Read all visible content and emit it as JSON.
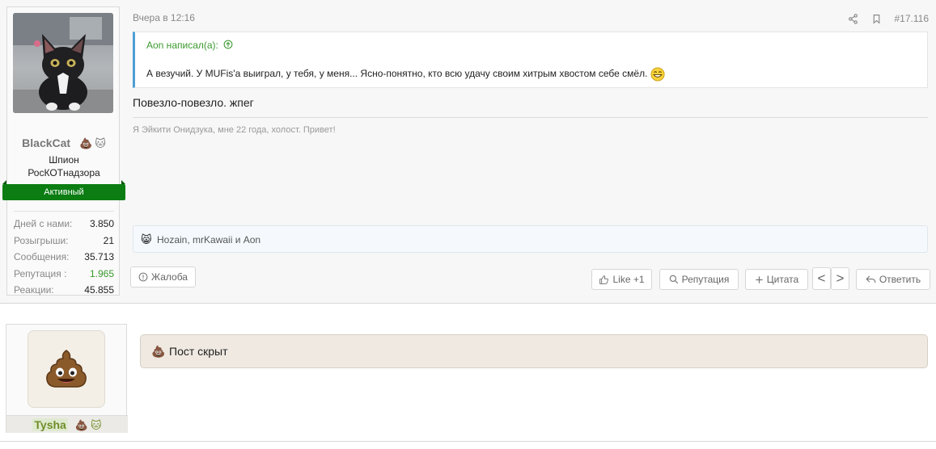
{
  "post1": {
    "user": {
      "name": "BlackCat",
      "badges": [
        "💩",
        "🐱"
      ],
      "title_line1": "Шпион",
      "title_line2": "РосКОТнадзора",
      "banner": "Активный",
      "stats": [
        {
          "label": "Дней с нами:",
          "value": "3.850"
        },
        {
          "label": "Розыгрыши:",
          "value": "21"
        },
        {
          "label": "Сообщения:",
          "value": "35.713"
        },
        {
          "label": "Репутация :",
          "value": "1.965"
        },
        {
          "label": "Реакции:",
          "value": "45.855"
        }
      ]
    },
    "date": "Вчера в 12:16",
    "post_number": "#17.116",
    "quote": {
      "author": "Aon написал(а):",
      "text": "А везучий. У MUFis'а выиграл, у тебя, у меня... Ясно-понятно, кто всю удачу своим хитрым хвостом себе смёл."
    },
    "text": "Повезло-повезло. жпег",
    "signature": "Я Эйкити Онидзука, мне 22 года, холост. Привет!",
    "reactions": {
      "emoji": "😸",
      "names": "Hozain, mrKawaii и Aon"
    },
    "actions": {
      "report": "Жалоба",
      "like": "Like +1",
      "reputation": "Репутация",
      "quote": "Цитата",
      "prev": "<",
      "next": ">",
      "reply": "Ответить"
    }
  },
  "post2": {
    "user": {
      "name": "Tysha",
      "badges": [
        "💩",
        "🐱"
      ]
    },
    "hidden_text": "Пост скрыт"
  },
  "colors": {
    "active_banner": "#0b7d12",
    "quote_bar": "#4da0d6",
    "quote_author": "#3a9a2e",
    "reputation_value": "#3a9a2e"
  }
}
